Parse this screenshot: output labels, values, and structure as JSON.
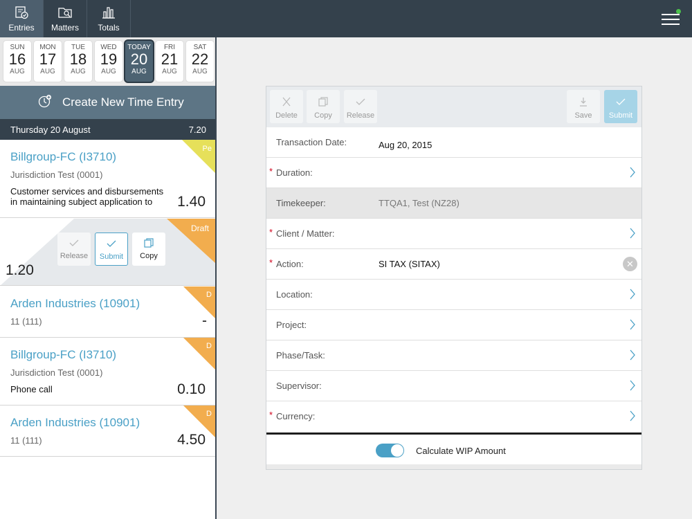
{
  "nav": {
    "tabs": [
      {
        "label": "Entries",
        "icon": "entries-icon",
        "active": true
      },
      {
        "label": "Matters",
        "icon": "matters-icon",
        "active": false
      },
      {
        "label": "Totals",
        "icon": "totals-icon",
        "active": false
      }
    ],
    "menu_icon": "hamburger-menu-icon",
    "notification_color": "#4dc24d"
  },
  "dates": [
    {
      "name": "SUN",
      "num": "16",
      "month": "AUG"
    },
    {
      "name": "MON",
      "num": "17",
      "month": "AUG"
    },
    {
      "name": "TUE",
      "num": "18",
      "month": "AUG"
    },
    {
      "name": "WED",
      "num": "19",
      "month": "AUG"
    },
    {
      "name": "TODAY",
      "num": "20",
      "month": "AUG",
      "selected": true
    },
    {
      "name": "FRI",
      "num": "21",
      "month": "AUG"
    },
    {
      "name": "SAT",
      "num": "22",
      "month": "AUG"
    }
  ],
  "create_entry": {
    "label": "Create New Time Entry",
    "icon": "clock-plus-icon"
  },
  "day_header": {
    "date": "Thursday  20 August",
    "total": "7.20"
  },
  "entries": [
    {
      "client": "Billgroup-FC (I3710)",
      "matter": "Jurisdiction Test (0001)",
      "narrative": "Customer services and disbursements in maintaining subject application to",
      "hours": "1.40",
      "status": "Pe",
      "status_color": "#e6e05a"
    },
    {
      "hours": "1.20",
      "status": "Draft",
      "status_color": "#f2ad4e",
      "actions": {
        "release": "Release",
        "submit": "Submit",
        "copy": "Copy"
      }
    },
    {
      "client": "Arden Industries (10901)",
      "matter": "11 (111)",
      "hours": "-",
      "status": "D",
      "status_color": "#f2ad4e"
    },
    {
      "client": "Billgroup-FC (I3710)",
      "matter": "Jurisdiction Test (0001)",
      "narrative": "Phone call",
      "hours": "0.10",
      "status": "D",
      "status_color": "#f2ad4e"
    },
    {
      "client": "Arden Industries (10901)",
      "matter": "11 (111)",
      "hours": "4.50",
      "status": "D",
      "status_color": "#f2ad4e"
    }
  ],
  "toolbar": {
    "delete": "Delete",
    "copy": "Copy",
    "release": "Release",
    "save": "Save",
    "submit": "Submit"
  },
  "form": {
    "transaction_date": {
      "label": "Transaction Date:",
      "value": "Aug 20, 2015"
    },
    "duration": {
      "label": "Duration:"
    },
    "timekeeper": {
      "label": "Timekeeper:",
      "value": "TTQA1, Test (NZ28)"
    },
    "client_matter": {
      "label": "Client / Matter:"
    },
    "action": {
      "label": "Action:",
      "value": "SI TAX (SITAX)"
    },
    "location": {
      "label": "Location:"
    },
    "project": {
      "label": "Project:"
    },
    "phase_task": {
      "label": "Phase/Task:"
    },
    "supervisor": {
      "label": "Supervisor:"
    },
    "currency": {
      "label": "Currency:"
    },
    "required_marker": "*"
  },
  "calculate_wip": {
    "label": "Calculate WIP Amount",
    "enabled": true
  },
  "colors": {
    "accent": "#4aa0c6",
    "header": "#34414c",
    "draft": "#f2ad4e",
    "pending": "#e6e05a"
  }
}
